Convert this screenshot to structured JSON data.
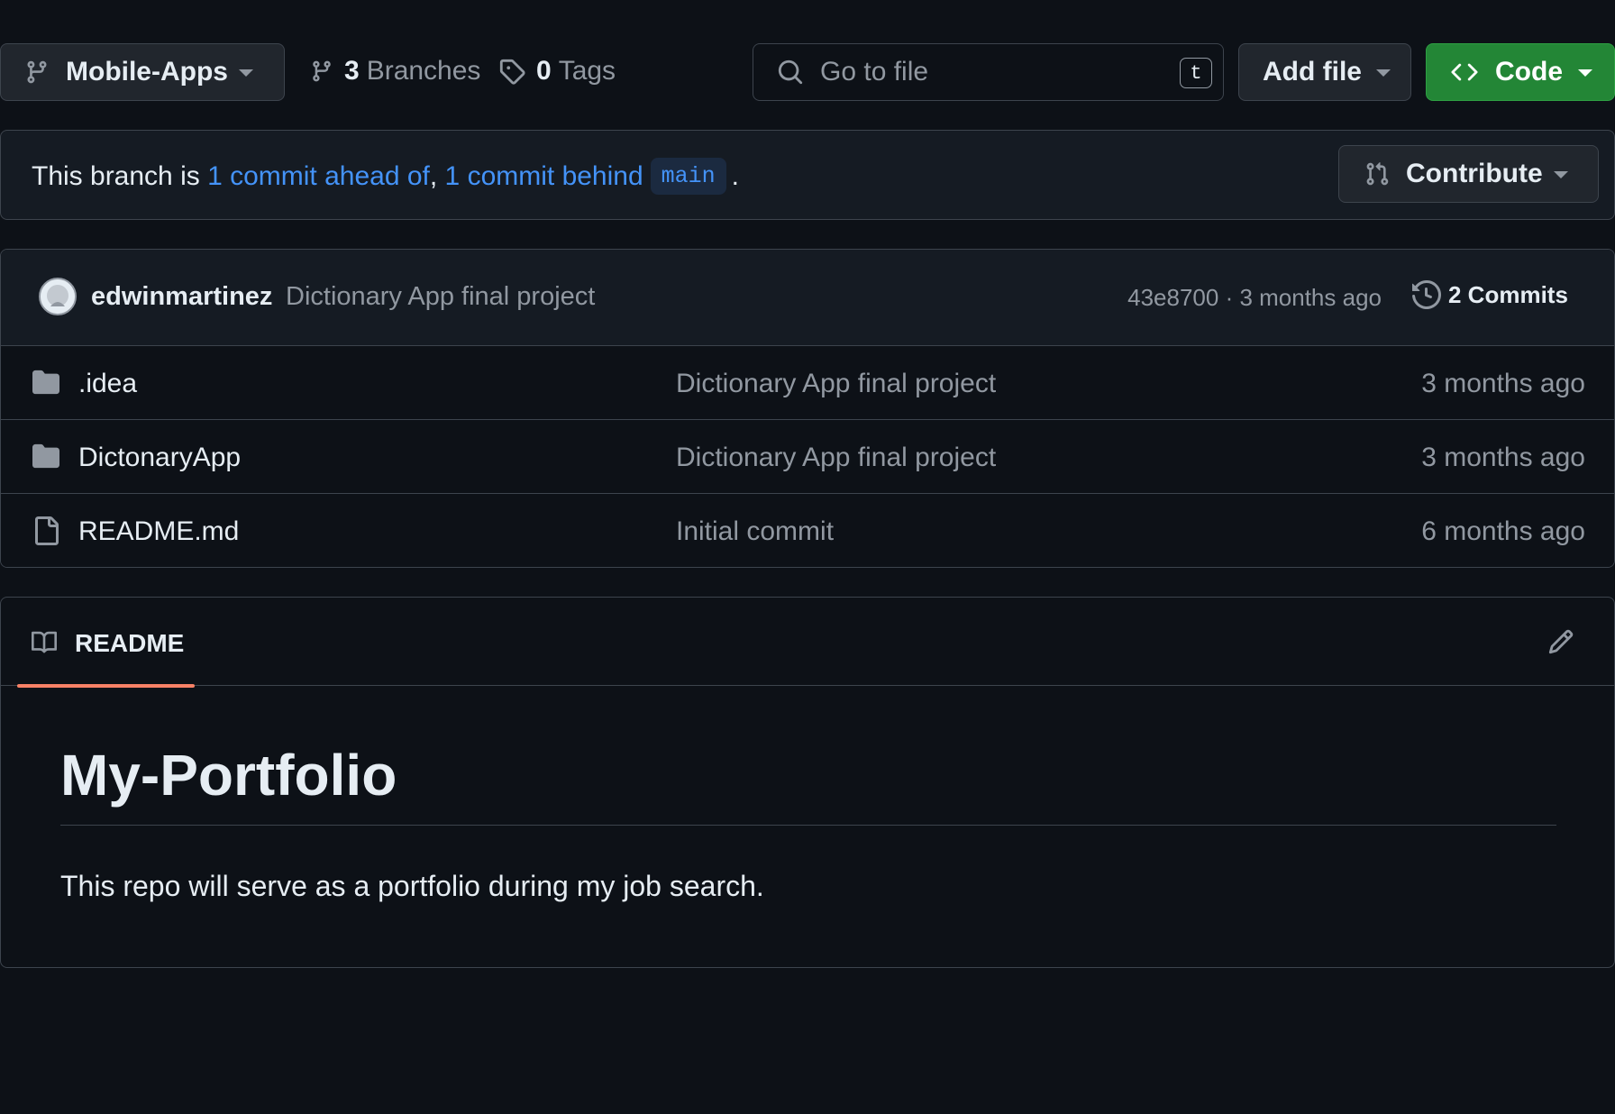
{
  "toolbar": {
    "branch_name": "Mobile-Apps",
    "branches_count": "3",
    "branches_label": "Branches",
    "tags_count": "0",
    "tags_label": "Tags",
    "search_placeholder": "Go to file",
    "search_shortcut": "t",
    "add_file_label": "Add file",
    "code_label": "Code"
  },
  "branch_status": {
    "prefix": "This branch is ",
    "ahead_link": "1 commit ahead of",
    "separator": ", ",
    "behind_link": "1 commit behind",
    "base_branch": "main",
    "suffix": ".",
    "contribute_label": "Contribute"
  },
  "latest_commit": {
    "author": "edwinmartinez",
    "message": "Dictionary App final project",
    "hash_time": "43e8700 · 3 months ago",
    "commits_label": "2 Commits"
  },
  "files": [
    {
      "name": ".idea",
      "type": "folder",
      "message": "Dictionary App final project",
      "time": "3 months ago"
    },
    {
      "name": "DictonaryApp",
      "type": "folder",
      "message": "Dictionary App final project",
      "time": "3 months ago"
    },
    {
      "name": "README.md",
      "type": "file",
      "message": "Initial commit",
      "time": "6 months ago"
    }
  ],
  "readme": {
    "tab_label": "README",
    "title": "My-Portfolio",
    "body": "This repo will serve as a portfolio during my job search."
  },
  "colors": {
    "background": "#0d1117",
    "accent_link": "#4493f8",
    "code_button": "#238636",
    "tab_underline": "#f78166"
  }
}
